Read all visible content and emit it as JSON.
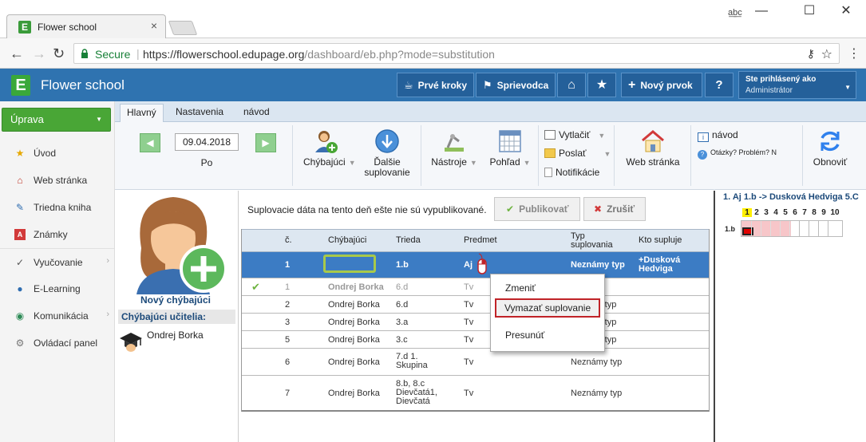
{
  "browser": {
    "tab_title": "Flower school",
    "tab_close": "×",
    "window_user": "a͟b͟c",
    "url_host": "https://flowerschool.edupage.org",
    "url_path": "/dashboard/eb.php?mode=substitution",
    "secure_label": "Secure",
    "separator": "|"
  },
  "header": {
    "logo_letter": "E",
    "title": "Flower school",
    "buttons": {
      "prve_kroky": "Prvé kroky",
      "sprievodca": "Sprievodca",
      "novy_prvok": "Nový prvok",
      "help": "?"
    },
    "user_line1": "Ste prihlásený ako",
    "user_line2": "Administrátor"
  },
  "sidebar": {
    "uprava": "Úprava",
    "items": [
      {
        "label": "Úvod"
      },
      {
        "label": "Web stránka"
      },
      {
        "label": "Triedna kniha"
      },
      {
        "label": "Známky"
      },
      {
        "label": "Vyučovanie"
      },
      {
        "label": "E-Learning"
      },
      {
        "label": "Komunikácia"
      },
      {
        "label": "Ovládací panel"
      }
    ]
  },
  "ribbon": {
    "tabs": [
      "Hlavný",
      "Nastavenia",
      "návod"
    ],
    "date": "09.04.2018",
    "day": "Po",
    "chybajuci": "Chýbajúci",
    "dalsie_line1": "Ďalšie",
    "dalsie_line2": "suplovanie",
    "nastroje": "Nástroje",
    "pohlad": "Pohľad",
    "vytlacit": "Vytlačiť",
    "poslat": "Poslať",
    "notifikacie": "Notifikácie",
    "web_stranka": "Web stránka",
    "navod": "návod",
    "otazky": "Otázky? Problém? N",
    "obnovit": "Obnoviť"
  },
  "missing": {
    "new_label": "Nový chýbajúci",
    "header": "Chýbajúci učitelia:",
    "teachers": [
      "Ondrej Borka"
    ]
  },
  "main": {
    "notice": "Suplovacie dáta na tento deň ešte nie sú vypublikované.",
    "publish": "Publikovať",
    "cancel": "Zrušiť",
    "columns": {
      "c": "č.",
      "chybajuci": "Chýbajúci",
      "trieda": "Trieda",
      "predmet": "Predmet",
      "typ_line1": "Typ",
      "typ_line2": "suplovania",
      "kto": "Kto supluje"
    },
    "rows": [
      {
        "c": "1",
        "chybajuci": "",
        "trieda": "1.b",
        "predmet": "Aj",
        "typ": "Neznámy typ",
        "kto_line1": "+Dusková",
        "kto_line2": "Hedviga",
        "state": "selected"
      },
      {
        "c": "1",
        "chybajuci": "Ondrej Borka",
        "trieda": "6.d",
        "predmet": "Tv",
        "typ": "",
        "kto_line1": "",
        "kto_line2": "",
        "state": "dim"
      },
      {
        "c": "2",
        "chybajuci": "Ondrej Borka",
        "trieda": "6.d",
        "predmet": "Tv",
        "typ": "ny typ",
        "kto_line1": "",
        "kto_line2": "",
        "state": ""
      },
      {
        "c": "3",
        "chybajuci": "Ondrej Borka",
        "trieda": "3.a",
        "predmet": "Tv",
        "typ": "ny typ",
        "kto_line1": "",
        "kto_line2": "",
        "state": ""
      },
      {
        "c": "5",
        "chybajuci": "Ondrej Borka",
        "trieda": "3.c",
        "predmet": "Tv",
        "typ": "ny typ",
        "kto_line1": "",
        "kto_line2": "",
        "state": ""
      },
      {
        "c": "6",
        "chybajuci": "Ondrej Borka",
        "trieda_lines": [
          "7.d 1.",
          "Skupina"
        ],
        "predmet": "Tv",
        "typ": "Neznámy typ",
        "kto_line1": "",
        "kto_line2": "",
        "state": ""
      },
      {
        "c": "7",
        "chybajuci": "Ondrej Borka",
        "trieda_lines": [
          "8.b, 8.c",
          "Dievčatá1,",
          "Dievčatá"
        ],
        "predmet": "Tv",
        "typ": "Neznámy typ",
        "kto_line1": "",
        "kto_line2": "",
        "state": ""
      }
    ]
  },
  "context_menu": {
    "zmenit": "Zmeniť",
    "vymazat": "Vymazať suplovanie",
    "presunut": "Presunúť"
  },
  "right_panel": {
    "title": "1. Aj 1.b -> Dusková Hedviga 5.C",
    "class_label": "1.b",
    "periods": [
      "1",
      "2",
      "3",
      "4",
      "5",
      "6",
      "7",
      "8",
      "9",
      "10"
    ]
  },
  "colors": {
    "header_blue": "#2f73b0",
    "green": "#49a636",
    "selected_row": "#3c7cc4",
    "highlight_red": "#c02328"
  }
}
